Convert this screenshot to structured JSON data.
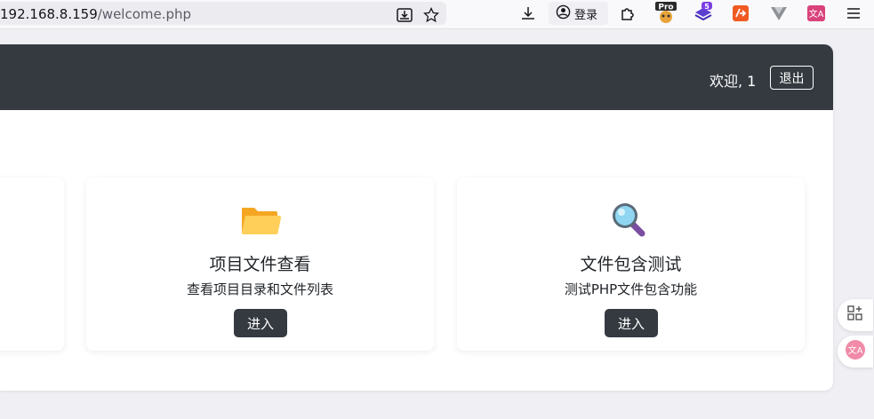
{
  "browser": {
    "url_host": "192.168.8.159",
    "url_path": "/welcome.php",
    "login_label": "登录",
    "ext_pro_label": "Pro",
    "ext_badge_count": "5",
    "translate_label": "文A"
  },
  "navbar": {
    "welcome_text": "欢迎, 1",
    "logout_label": "退出"
  },
  "cards": [
    {
      "title": "项目文件查看",
      "description": "查看项目目录和文件列表",
      "button_label": "进入",
      "icon": "folder-icon"
    },
    {
      "title": "文件包含测试",
      "description": "测试PHP文件包含功能",
      "button_label": "进入",
      "icon": "magnifier-icon"
    }
  ],
  "colors": {
    "navbar_bg": "#343a40",
    "button_bg": "#343a40",
    "page_bg": "#f0f0f4"
  }
}
